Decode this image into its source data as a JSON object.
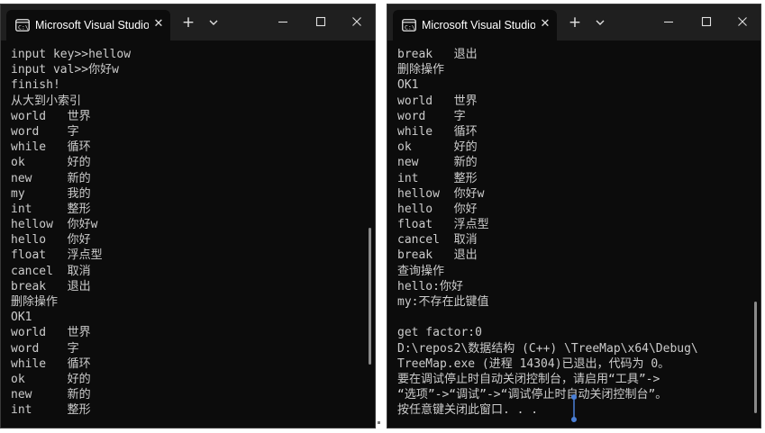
{
  "windows": [
    {
      "tab_title": "Microsoft Visual Studio",
      "new_tab_label": "+",
      "close_tab_label": "✕",
      "lines": [
        "input key>>hellow",
        "input val>>你好w",
        "finish!",
        "从大到小索引",
        "world   世界",
        "word    字",
        "while   循环",
        "ok      好的",
        "new     新的",
        "my      我的",
        "int     整形",
        "hellow  你好w",
        "hello   你好",
        "float   浮点型",
        "cancel  取消",
        "break   退出",
        "删除操作",
        "OK1",
        "world   世界",
        "word    字",
        "while   循环",
        "ok      好的",
        "new     新的",
        "int     整形"
      ]
    },
    {
      "tab_title": "Microsoft Visual Studio",
      "new_tab_label": "+",
      "close_tab_label": "✕",
      "lines": [
        "break   退出",
        "删除操作",
        "OK1",
        "world   世界",
        "word    字",
        "while   循环",
        "ok      好的",
        "new     新的",
        "int     整形",
        "hellow  你好w",
        "hello   你好",
        "float   浮点型",
        "cancel  取消",
        "break   退出",
        "查询操作",
        "hello:你好",
        "my:不存在此键值",
        "",
        "get factor:0",
        "D:\\repos2\\数据结构 (C++) \\TreeMap\\x64\\Debug\\",
        "TreeMap.exe (进程 14304)已退出，代码为 0。",
        "要在调试停止时自动关闭控制台，请启用“工具”->",
        "“选项”->“调试”->“调试停止时自动关闭控制台”。",
        "按任意键关闭此窗口. . ."
      ]
    }
  ],
  "colors": {
    "console_bg": "#0c0c0c",
    "titlebar_bg": "#1f1f1f",
    "text": "#cccccc",
    "cursor_accent": "#4a7fd6"
  }
}
